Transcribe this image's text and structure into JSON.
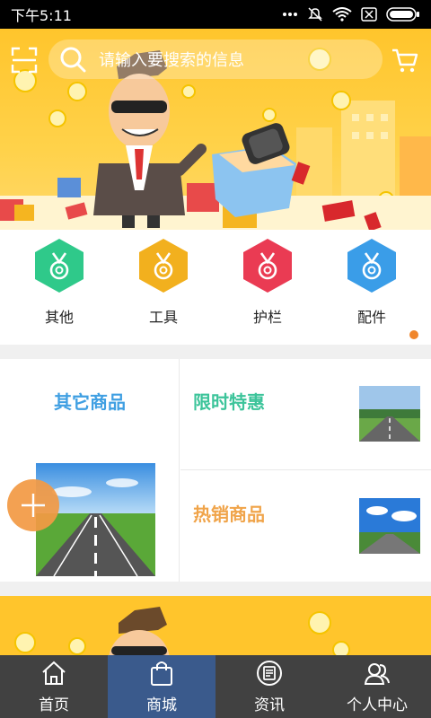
{
  "status_bar": {
    "time": "下午5:11",
    "icons": [
      "more-dots-icon",
      "mute-icon",
      "wifi-icon",
      "sim-icon",
      "battery-icon"
    ]
  },
  "header": {
    "search_placeholder": "请输入要搜索的信息",
    "scan_icon": "scan-icon",
    "cart_icon": "cart-icon"
  },
  "categories": [
    {
      "label": "其他",
      "color": "#2fc98a",
      "icon": "medal-icon"
    },
    {
      "label": "工具",
      "color": "#f2b01e",
      "icon": "medal-icon"
    },
    {
      "label": "护栏",
      "color": "#ea3b53",
      "icon": "medal-icon"
    },
    {
      "label": "配件",
      "color": "#3a9de8",
      "icon": "medal-icon"
    }
  ],
  "products": {
    "left": {
      "title": "其它商品",
      "color": "#3f9fe2"
    },
    "right_top": {
      "title": "限时特惠",
      "color": "#3cc49a"
    },
    "right_bottom": {
      "title": "热销商品",
      "color": "#f0a44a"
    }
  },
  "tabbar": {
    "items": [
      {
        "label": "首页",
        "icon": "home-icon",
        "active": false
      },
      {
        "label": "商城",
        "icon": "shopping-bag-icon",
        "active": true
      },
      {
        "label": "资讯",
        "icon": "news-icon",
        "active": false
      },
      {
        "label": "个人中心",
        "icon": "user-center-icon",
        "active": false
      }
    ]
  },
  "colors": {
    "banner": "#ffc52c",
    "tab_active": "#3a5a8c",
    "tabbar": "#414141",
    "fab": "#f39a44"
  }
}
